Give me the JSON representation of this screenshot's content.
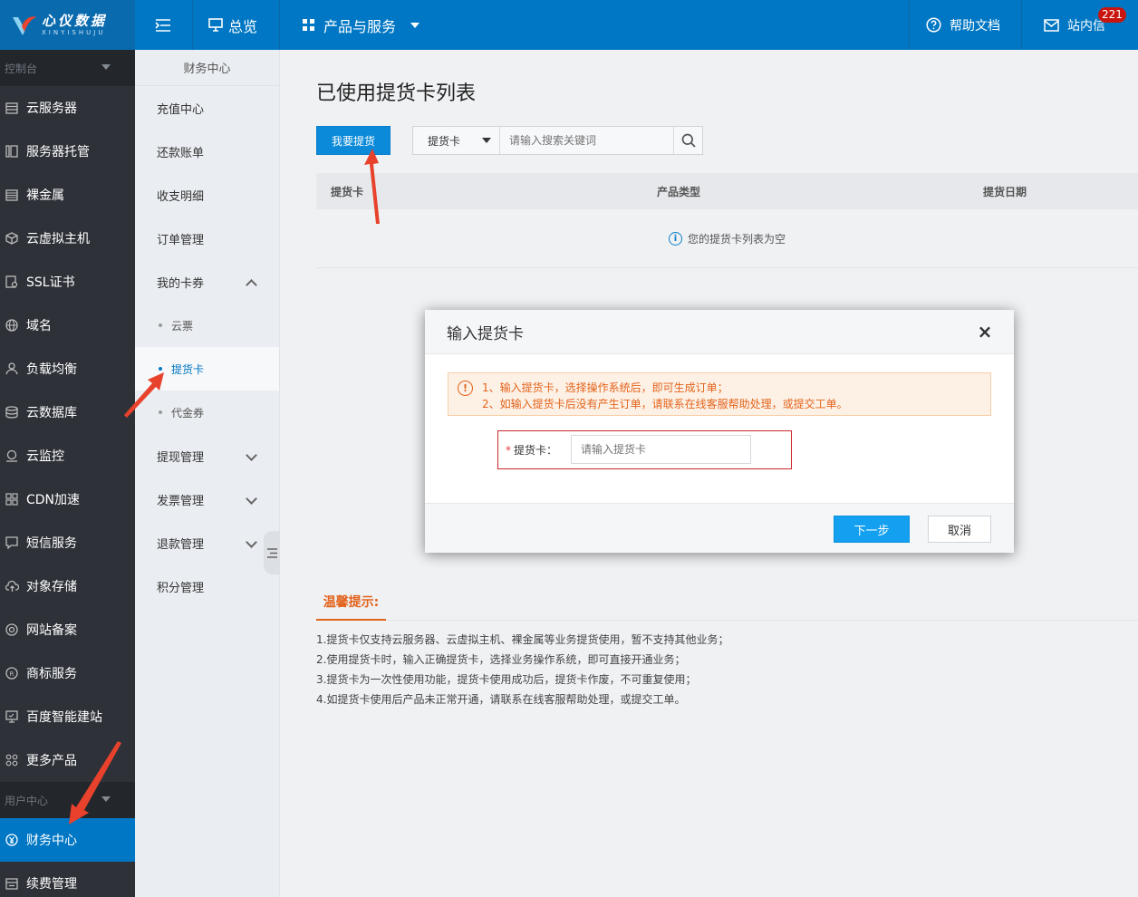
{
  "colors": {
    "accent": "#0077c4",
    "sidebar_bg": "#2e3238",
    "warn": "#e3631b",
    "arrow": "#e8412c"
  },
  "topbar": {
    "logo_cn": "心仪数据",
    "logo_en": "XINYISHUJU",
    "overview": "总览",
    "products": "产品与服务",
    "help": "帮助文档",
    "inbox": "站内信",
    "inbox_count": "221"
  },
  "sidebar": {
    "section_console": "控制台",
    "items": [
      {
        "label": "云服务器",
        "icon": "server-icon"
      },
      {
        "label": "服务器托管",
        "icon": "hosting-icon"
      },
      {
        "label": "裸金属",
        "icon": "bare-metal-icon"
      },
      {
        "label": "云虚拟主机",
        "icon": "cube-icon"
      },
      {
        "label": "SSL证书",
        "icon": "certificate-icon"
      },
      {
        "label": "域名",
        "icon": "globe-icon"
      },
      {
        "label": "负载均衡",
        "icon": "balance-icon"
      },
      {
        "label": "云数据库",
        "icon": "database-icon"
      },
      {
        "label": "云监控",
        "icon": "monitor-icon"
      },
      {
        "label": "CDN加速",
        "icon": "cdn-icon"
      },
      {
        "label": "短信服务",
        "icon": "sms-icon"
      },
      {
        "label": "对象存储",
        "icon": "cloud-upload-icon"
      },
      {
        "label": "网站备案",
        "icon": "record-icon"
      },
      {
        "label": "商标服务",
        "icon": "trademark-icon"
      },
      {
        "label": "百度智能建站",
        "icon": "website-icon"
      },
      {
        "label": "更多产品",
        "icon": "more-icon"
      }
    ],
    "section_user": "用户中心",
    "user_items": [
      {
        "label": "财务中心",
        "icon": "yen-icon"
      },
      {
        "label": "续费管理",
        "icon": "renew-icon"
      }
    ]
  },
  "subnav": {
    "title": "财务中心",
    "recharge": "充值中心",
    "repay": "还款账单",
    "income": "收支明细",
    "orders": "订单管理",
    "coupons": "我的卡券",
    "cloud_ticket": "云票",
    "pickup_card": "提货卡",
    "voucher": "代金券",
    "withdraw": "提现管理",
    "invoice": "发票管理",
    "refund": "退款管理",
    "points": "积分管理"
  },
  "main": {
    "title": "已使用提货卡列表",
    "pickup_button": "我要提货",
    "search_type": "提货卡",
    "search_placeholder": "请输入搜索关键词",
    "columns": [
      "提货卡",
      "产品类型",
      "提货日期"
    ],
    "empty_text": "您的提货卡列表为空",
    "tips_title": "温馨提示:",
    "tips": [
      "1.提货卡仅支持云服务器、云虚拟主机、裸金属等业务提货使用，暂不支持其他业务；",
      "2.使用提货卡时，输入正确提货卡，选择业务操作系统，即可直接开通业务；",
      "3.提货卡为一次性使用功能，提货卡使用成功后，提货卡作废，不可重复使用；",
      "4.如提货卡使用后产品未正常开通，请联系在线客服帮助处理，或提交工单。"
    ]
  },
  "dialog": {
    "title": "输入提货卡",
    "warn_line1": "1、输入提货卡，选择操作系统后，即可生成订单；",
    "warn_line2": "2、如输入提货卡后没有产生订单，请联系在线客服帮助处理，或提交工单。",
    "field_label": "提货卡：",
    "field_placeholder": "请输入提货卡",
    "next": "下一步",
    "cancel": "取消"
  }
}
